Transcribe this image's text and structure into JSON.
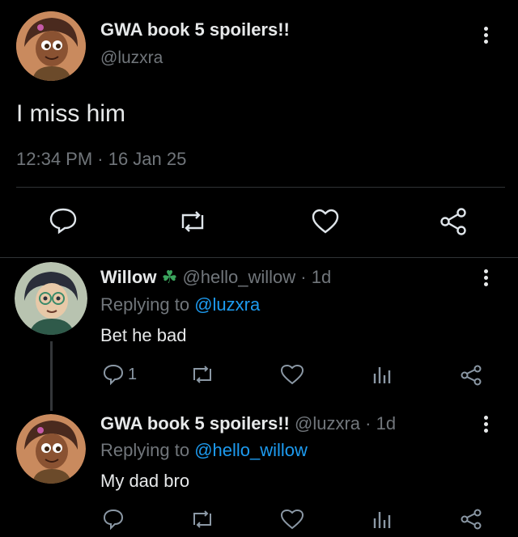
{
  "main_tweet": {
    "display_name": "GWA book 5 spoilers!!",
    "handle": "@luzxra",
    "text": "I miss him",
    "timestamp": "12:34 PM · 16 Jan 25"
  },
  "replies": [
    {
      "display_name": "Willow",
      "emoji": "☘",
      "handle_time": "@hello_willow · 1d",
      "replying_prefix": "Replying to",
      "replying_to": "@luzxra",
      "text": "Bet he bad",
      "reply_count": "1"
    },
    {
      "display_name": "GWA book 5 spoilers!!",
      "handle_time": "@luzxra · 1d",
      "replying_prefix": "Replying to",
      "replying_to": "@hello_willow",
      "text": "My dad bro",
      "reply_count": ""
    }
  ],
  "icons": [
    "reply-icon",
    "retweet-icon",
    "like-icon",
    "share-icon",
    "analytics-icon",
    "more-icon"
  ],
  "colors": {
    "background": "#000000",
    "text": "#e7e9ea",
    "muted": "#71767b",
    "link": "#1d9bf0",
    "clover": "#3ba55d"
  }
}
